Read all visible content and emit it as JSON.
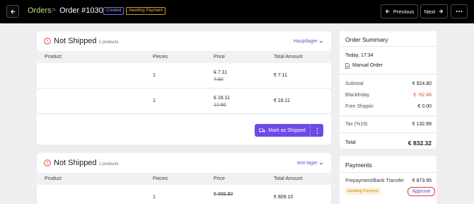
{
  "header": {
    "breadcrumb_orders": "Orders",
    "separator": ">",
    "order_title": "Order #1030",
    "badge_created": "Created",
    "badge_payment": "Awaiting Payment",
    "prev_label": "Previous",
    "next_label": "Next"
  },
  "icons": {
    "back": "arrow-left-icon",
    "prev": "arrow-left-icon",
    "next": "arrow-right-icon",
    "more": "ellipsis-icon",
    "warning": "alert-circle-icon",
    "truck": "truck-icon",
    "document": "document-icon",
    "chevron": "chevron-down-icon"
  },
  "colors": {
    "accent": "#6d4be8",
    "breadcrumb": "#b7e47a",
    "warning": "#e84a3f",
    "created_badge": "#7b68ee",
    "payment_badge": "#d59a2a"
  },
  "shipments": [
    {
      "title": "Not Shipped",
      "count": "2 products",
      "warehouse": "Hauptlager",
      "columns": [
        "Product",
        "Pieces",
        "Price",
        "Total Amount"
      ],
      "rows": [
        {
          "product": "",
          "pieces": "1",
          "price_old": "€ 7.90",
          "price": "€ 7.11",
          "total": "€ 7.11"
        },
        {
          "product": "",
          "pieces": "1",
          "price_old": "€ 17.90",
          "price": "€ 16.11",
          "total": "€ 16.11"
        }
      ],
      "action_label": "Mark as Shipped"
    },
    {
      "title": "Not Shipped",
      "count": "1 products",
      "warehouse": "test-lager",
      "columns": [
        "Product",
        "Pieces",
        "Price",
        "Total Amount"
      ],
      "rows": [
        {
          "product": "",
          "pieces": "1",
          "price_old": "€ 899.00",
          "price": "€ 809.10",
          "total": "€ 809.10"
        }
      ]
    }
  ],
  "summary": {
    "title": "Order Summary",
    "date": "Today, 17:34",
    "source": "Manual Order",
    "subtotal_label": "Subtotal",
    "subtotal": "€ 924.80",
    "discount_label": "Blackfriday",
    "discount": "€ -92.48",
    "shipping_label": "Free Shippin",
    "shipping": "€ 0.00",
    "tax_label": "Tax (%19)",
    "tax": "€ 132.89",
    "total_label": "Total",
    "total": "€ 832.32"
  },
  "payments": {
    "title": "Payments",
    "method": "Prepayment/Bank Transfer",
    "amount": "€ 873.95",
    "status": "Awaiting Payment",
    "approve_label": "Approve"
  }
}
